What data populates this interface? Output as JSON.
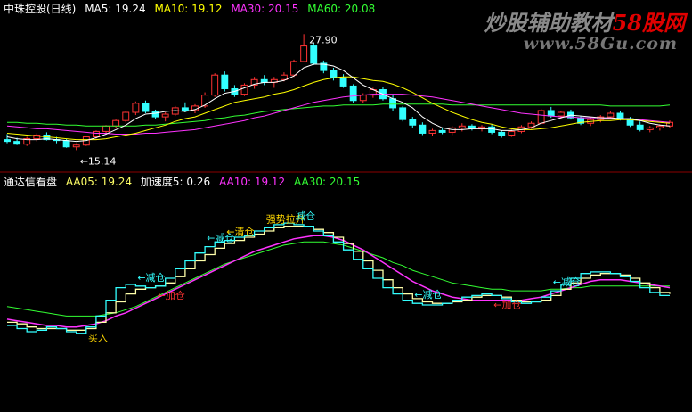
{
  "colors": {
    "bg": "#000000",
    "up": "#ff3333",
    "down": "#33ffff",
    "ma5": "#ffffff",
    "ma10": "#ffff00",
    "ma30": "#ff33ff",
    "ma60": "#33ff33",
    "separator": "#8b0000",
    "buy": "#ffd700",
    "reduce": "#33ffff",
    "add": "#ff3333",
    "ind_line1": "#33ffff",
    "ind_line2": "#ffffaa",
    "ind_line3": "#ff33ff",
    "ind_line4": "#33ff33"
  },
  "header_top": {
    "name": "中珠控股(日线)",
    "ma5": "MA5: 19.24",
    "ma10": "MA10: 19.12",
    "ma30": "MA30: 20.15",
    "ma60": "MA60: 20.08"
  },
  "header_bottom": {
    "name": "通达信看盘",
    "aa05": "AA05: 19.24",
    "speed": "加速度5: 0.26",
    "aa10": "AA10: 19.12",
    "aa30": "AA30: 20.15"
  },
  "watermark": {
    "prefix": "炒股辅助教材",
    "brand": "58股网",
    "url": "www.58Gu.com"
  },
  "chart_data": [
    {
      "type": "candlestick",
      "price_range": [
        14.2,
        29.5
      ],
      "high_label": "27.90",
      "low_label": "←15.14",
      "candles_ohlc": [
        [
          16.3,
          16.9,
          15.9,
          16.1
        ],
        [
          16.1,
          16.5,
          15.7,
          15.8
        ],
        [
          15.8,
          16.6,
          15.6,
          16.4
        ],
        [
          16.4,
          17.0,
          16.1,
          16.8
        ],
        [
          16.8,
          17.1,
          16.2,
          16.3
        ],
        [
          16.3,
          16.6,
          15.9,
          16.2
        ],
        [
          16.2,
          16.4,
          15.4,
          15.5
        ],
        [
          15.5,
          15.9,
          15.14,
          15.7
        ],
        [
          15.7,
          16.7,
          15.6,
          16.6
        ],
        [
          16.6,
          17.3,
          16.4,
          17.2
        ],
        [
          17.2,
          17.9,
          17.0,
          17.8
        ],
        [
          17.8,
          18.5,
          17.6,
          18.4
        ],
        [
          18.4,
          19.4,
          18.2,
          19.3
        ],
        [
          19.3,
          20.5,
          19.0,
          20.3
        ],
        [
          20.3,
          20.6,
          19.2,
          19.4
        ],
        [
          19.4,
          19.6,
          18.6,
          18.8
        ],
        [
          18.8,
          19.3,
          18.3,
          19.1
        ],
        [
          19.1,
          20.0,
          18.9,
          19.8
        ],
        [
          19.8,
          20.4,
          19.3,
          19.5
        ],
        [
          19.5,
          20.2,
          19.2,
          20.0
        ],
        [
          20.0,
          21.5,
          19.8,
          21.2
        ],
        [
          21.2,
          23.6,
          21.0,
          23.4
        ],
        [
          23.4,
          23.8,
          21.6,
          21.9
        ],
        [
          21.9,
          22.3,
          21.0,
          21.3
        ],
        [
          21.3,
          22.5,
          21.1,
          22.3
        ],
        [
          22.3,
          23.2,
          21.9,
          22.9
        ],
        [
          22.9,
          23.4,
          22.3,
          22.6
        ],
        [
          22.6,
          23.2,
          22.0,
          22.9
        ],
        [
          22.9,
          23.7,
          22.7,
          23.4
        ],
        [
          23.4,
          25.1,
          23.2,
          24.9
        ],
        [
          24.9,
          27.9,
          24.8,
          26.6
        ],
        [
          26.6,
          26.9,
          24.5,
          24.7
        ],
        [
          24.7,
          25.0,
          23.6,
          23.9
        ],
        [
          23.9,
          24.2,
          22.8,
          23.1
        ],
        [
          23.1,
          23.5,
          22.0,
          22.2
        ],
        [
          22.2,
          22.4,
          20.3,
          20.6
        ],
        [
          20.6,
          21.4,
          20.3,
          21.2
        ],
        [
          21.2,
          22.0,
          20.9,
          21.8
        ],
        [
          21.8,
          22.1,
          20.6,
          20.8
        ],
        [
          20.8,
          21.2,
          19.5,
          19.8
        ],
        [
          19.8,
          20.0,
          18.3,
          18.5
        ],
        [
          18.5,
          18.8,
          17.6,
          17.9
        ],
        [
          17.9,
          18.2,
          16.8,
          17.0
        ],
        [
          17.0,
          17.5,
          16.7,
          17.3
        ],
        [
          17.3,
          17.6,
          16.9,
          17.1
        ],
        [
          17.1,
          17.8,
          16.8,
          17.6
        ],
        [
          17.6,
          18.1,
          17.2,
          17.8
        ],
        [
          17.8,
          18.0,
          17.3,
          17.5
        ],
        [
          17.5,
          17.9,
          17.2,
          17.7
        ],
        [
          17.7,
          18.0,
          16.9,
          17.1
        ],
        [
          17.1,
          17.3,
          16.5,
          16.8
        ],
        [
          16.8,
          17.4,
          16.6,
          17.2
        ],
        [
          17.2,
          17.9,
          17.0,
          17.7
        ],
        [
          17.7,
          18.3,
          17.5,
          18.1
        ],
        [
          18.1,
          19.7,
          18.0,
          19.5
        ],
        [
          19.5,
          19.9,
          18.7,
          18.9
        ],
        [
          18.9,
          19.5,
          18.6,
          19.3
        ],
        [
          19.3,
          19.6,
          18.5,
          18.7
        ],
        [
          18.7,
          18.9,
          17.9,
          18.1
        ],
        [
          18.1,
          18.7,
          17.8,
          18.5
        ],
        [
          18.5,
          19.0,
          18.2,
          18.8
        ],
        [
          18.8,
          19.4,
          18.6,
          19.2
        ],
        [
          19.2,
          19.5,
          18.4,
          18.6
        ],
        [
          18.6,
          18.8,
          17.7,
          17.9
        ],
        [
          17.9,
          18.3,
          17.2,
          17.4
        ],
        [
          17.4,
          17.8,
          17.1,
          17.6
        ],
        [
          17.6,
          18.0,
          17.3,
          17.8
        ],
        [
          17.8,
          18.4,
          17.6,
          18.2
        ]
      ],
      "ma5": [
        16.6,
        16.4,
        16.3,
        16.3,
        16.4,
        16.3,
        16.2,
        16.1,
        16.2,
        16.5,
        16.9,
        17.4,
        17.9,
        18.6,
        19.1,
        19.2,
        19.4,
        19.5,
        19.4,
        19.6,
        20.1,
        20.8,
        21.4,
        21.6,
        22.0,
        22.4,
        22.6,
        22.6,
        22.8,
        23.3,
        24.2,
        24.6,
        24.6,
        24.4,
        23.9,
        23.1,
        22.3,
        21.8,
        21.3,
        20.8,
        20.4,
        19.8,
        18.8,
        18.1,
        17.6,
        17.4,
        17.4,
        17.5,
        17.5,
        17.5,
        17.3,
        17.3,
        17.4,
        17.6,
        18.1,
        18.4,
        18.7,
        19.0,
        18.9,
        18.8,
        18.7,
        18.7,
        18.6,
        18.6,
        18.4,
        18.1,
        17.9,
        17.8
      ],
      "ma10": [
        17.0,
        16.9,
        16.8,
        16.7,
        16.6,
        16.5,
        16.4,
        16.3,
        16.3,
        16.3,
        16.4,
        16.6,
        16.8,
        17.0,
        17.3,
        17.6,
        17.9,
        18.3,
        18.6,
        18.8,
        19.2,
        19.6,
        20.0,
        20.4,
        20.6,
        20.8,
        21.0,
        21.3,
        21.5,
        21.8,
        22.2,
        22.6,
        22.9,
        23.1,
        23.2,
        23.2,
        23.0,
        22.8,
        22.7,
        22.4,
        22.0,
        21.5,
        20.9,
        20.3,
        19.8,
        19.3,
        18.9,
        18.5,
        18.2,
        18.0,
        17.7,
        17.5,
        17.4,
        17.4,
        17.5,
        17.6,
        17.8,
        18.0,
        18.2,
        18.3,
        18.4,
        18.4,
        18.5,
        18.5,
        18.4,
        18.3,
        18.2,
        18.1
      ],
      "ma30": [
        17.8,
        17.7,
        17.6,
        17.5,
        17.5,
        17.4,
        17.3,
        17.2,
        17.1,
        17.0,
        17.0,
        16.9,
        16.9,
        16.9,
        17.0,
        17.0,
        17.1,
        17.2,
        17.3,
        17.4,
        17.6,
        17.8,
        18.0,
        18.2,
        18.4,
        18.7,
        18.9,
        19.2,
        19.5,
        19.8,
        20.1,
        20.4,
        20.6,
        20.8,
        21.0,
        21.1,
        21.2,
        21.3,
        21.3,
        21.3,
        21.3,
        21.2,
        21.1,
        21.0,
        20.8,
        20.6,
        20.4,
        20.2,
        20.0,
        19.8,
        19.6,
        19.4,
        19.2,
        19.1,
        19.0,
        18.9,
        18.8,
        18.8,
        18.7,
        18.7,
        18.7,
        18.6,
        18.6,
        18.6,
        18.5,
        18.4,
        18.3,
        18.2
      ],
      "ma60": [
        18.2,
        18.2,
        18.1,
        18.1,
        18.0,
        18.0,
        17.9,
        17.9,
        17.8,
        17.8,
        17.8,
        17.8,
        17.8,
        17.8,
        17.9,
        17.9,
        18.0,
        18.1,
        18.2,
        18.3,
        18.4,
        18.6,
        18.7,
        18.9,
        19.0,
        19.2,
        19.4,
        19.5,
        19.6,
        19.7,
        19.8,
        19.9,
        20.0,
        20.0,
        20.1,
        20.1,
        20.1,
        20.1,
        20.2,
        20.2,
        20.2,
        20.2,
        20.2,
        20.2,
        20.2,
        20.1,
        20.1,
        20.1,
        20.1,
        20.1,
        20.1,
        20.1,
        20.1,
        20.1,
        20.1,
        20.1,
        20.1,
        20.1,
        20.1,
        20.1,
        20.1,
        20.0,
        20.0,
        20.0,
        20.0,
        20.0,
        20.0,
        20.1
      ]
    },
    {
      "type": "line",
      "y_range": [
        14.5,
        23.5
      ],
      "aa05": [
        16.2,
        16.0,
        15.8,
        15.9,
        16.1,
        16.0,
        15.8,
        15.7,
        16.1,
        16.8,
        17.8,
        18.6,
        18.8,
        18.7,
        18.6,
        18.7,
        19.2,
        19.8,
        20.3,
        20.8,
        21.2,
        21.5,
        21.6,
        21.8,
        21.9,
        22.2,
        22.4,
        22.6,
        22.7,
        22.6,
        22.5,
        22.2,
        21.9,
        21.5,
        21.0,
        20.4,
        19.8,
        19.2,
        18.6,
        18.2,
        17.8,
        17.6,
        17.5,
        17.5,
        17.6,
        17.8,
        18.0,
        18.1,
        18.2,
        18.1,
        17.9,
        17.7,
        17.6,
        17.7,
        18.0,
        18.4,
        18.8,
        19.2,
        19.5,
        19.6,
        19.6,
        19.5,
        19.3,
        19.0,
        18.6,
        18.3,
        18.1,
        18.1
      ],
      "aa10": [
        16.4,
        16.3,
        16.1,
        16.0,
        16.0,
        16.0,
        15.9,
        15.9,
        16.0,
        16.4,
        17.0,
        17.7,
        18.2,
        18.5,
        18.6,
        18.7,
        18.9,
        19.3,
        19.8,
        20.3,
        20.7,
        21.1,
        21.4,
        21.6,
        21.8,
        22.0,
        22.2,
        22.4,
        22.5,
        22.5,
        22.5,
        22.3,
        22.1,
        21.8,
        21.4,
        20.9,
        20.3,
        19.7,
        19.1,
        18.6,
        18.2,
        17.9,
        17.7,
        17.6,
        17.6,
        17.7,
        17.8,
        18.0,
        18.1,
        18.1,
        18.0,
        17.8,
        17.7,
        17.7,
        17.8,
        18.1,
        18.5,
        18.9,
        19.2,
        19.4,
        19.5,
        19.5,
        19.4,
        19.2,
        18.9,
        18.6,
        18.3,
        18.2
      ],
      "aa30": [
        16.6,
        16.5,
        16.4,
        16.3,
        16.2,
        16.2,
        16.1,
        16.1,
        16.2,
        16.3,
        16.5,
        16.8,
        17.0,
        17.3,
        17.6,
        17.9,
        18.2,
        18.5,
        18.8,
        19.1,
        19.4,
        19.7,
        20.0,
        20.3,
        20.6,
        20.9,
        21.1,
        21.3,
        21.5,
        21.7,
        21.8,
        21.9,
        21.9,
        21.8,
        21.6,
        21.3,
        21.0,
        20.6,
        20.2,
        19.8,
        19.4,
        19.0,
        18.7,
        18.4,
        18.2,
        18.0,
        17.9,
        17.8,
        17.8,
        17.8,
        17.8,
        17.8,
        17.8,
        17.9,
        18.0,
        18.2,
        18.4,
        18.6,
        18.8,
        19.0,
        19.1,
        19.1,
        19.1,
        19.0,
        18.9,
        18.8,
        18.7,
        18.6
      ],
      "aa60": [
        17.4,
        17.3,
        17.2,
        17.1,
        17.0,
        16.9,
        16.8,
        16.8,
        16.8,
        16.8,
        16.9,
        17.0,
        17.2,
        17.4,
        17.7,
        18.0,
        18.3,
        18.6,
        18.9,
        19.2,
        19.5,
        19.8,
        20.1,
        20.3,
        20.5,
        20.7,
        20.9,
        21.1,
        21.3,
        21.4,
        21.5,
        21.5,
        21.5,
        21.4,
        21.3,
        21.1,
        20.9,
        20.7,
        20.5,
        20.2,
        20.0,
        19.7,
        19.5,
        19.3,
        19.1,
        18.9,
        18.8,
        18.7,
        18.6,
        18.5,
        18.5,
        18.4,
        18.4,
        18.4,
        18.4,
        18.5,
        18.5,
        18.6,
        18.6,
        18.7,
        18.7,
        18.7,
        18.7,
        18.7,
        18.7,
        18.7,
        18.7,
        18.7
      ],
      "signals": [
        {
          "index": 8,
          "label": "买入",
          "kind": "buy"
        },
        {
          "index": 13,
          "label": "←减仓",
          "kind": "reduce"
        },
        {
          "index": 15,
          "label": "←加仓",
          "kind": "add"
        },
        {
          "index": 20,
          "label": "←减仓",
          "kind": "reduce"
        },
        {
          "index": 22,
          "label": "←清仓",
          "kind": "buy"
        },
        {
          "index": 26,
          "label": "强势拉升",
          "kind": "buy"
        },
        {
          "index": 29,
          "label": "减仓",
          "kind": "reduce"
        },
        {
          "index": 41,
          "label": "←减仓",
          "kind": "reduce"
        },
        {
          "index": 49,
          "label": "←加仓",
          "kind": "add"
        },
        {
          "index": 55,
          "label": "←减仓",
          "kind": "reduce"
        }
      ]
    }
  ]
}
